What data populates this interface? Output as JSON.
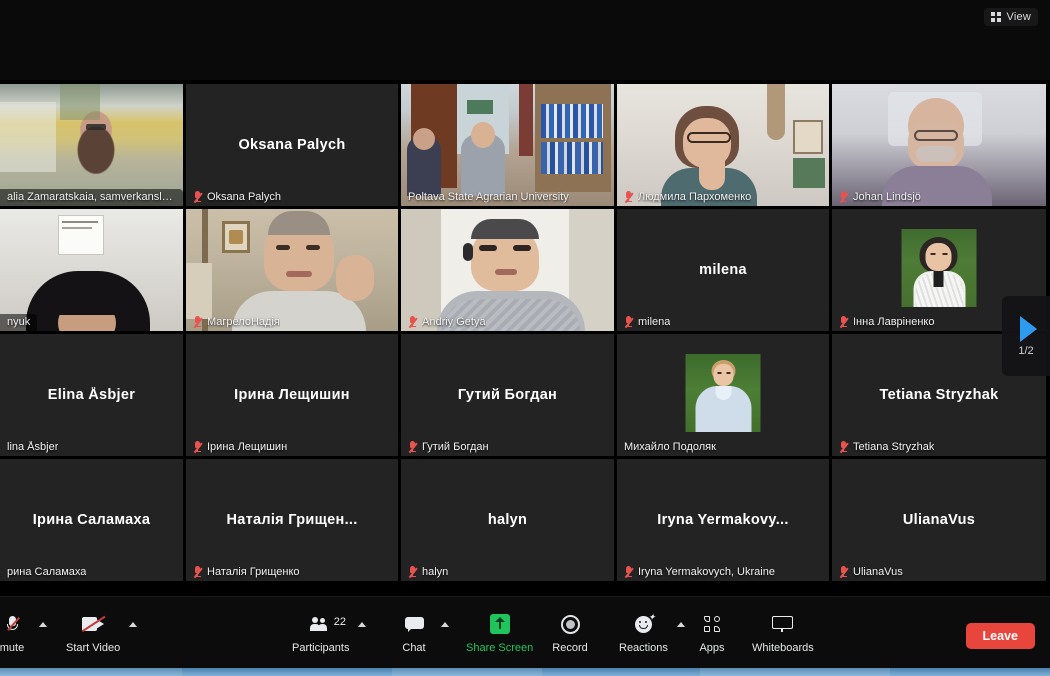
{
  "app": {
    "title": "Zoom Meeting",
    "view_label": "View",
    "view_icon": "grid-icon"
  },
  "page_nav": {
    "counter": "1/2",
    "icon": "next-page-arrow-icon"
  },
  "gallery": {
    "rows": 4,
    "cols": 5,
    "active_tile_color": "#b9e02a",
    "tiles": [
      {
        "id": "t1",
        "name_label": "alia Zamaratskaia, samverkanslekt...",
        "display_name": "",
        "video": true,
        "muted": false,
        "active": false,
        "avatar": false
      },
      {
        "id": "t2",
        "name_label": "Oksana Palych",
        "display_name": "Oksana Palych",
        "video": false,
        "muted": true,
        "active": false,
        "avatar": false
      },
      {
        "id": "t3",
        "name_label": "Poltava State Agrarian University",
        "display_name": "",
        "video": true,
        "muted": false,
        "active": true,
        "avatar": false
      },
      {
        "id": "t4",
        "name_label": "Людмила Пархоменко",
        "display_name": "",
        "video": true,
        "muted": true,
        "active": false,
        "avatar": false
      },
      {
        "id": "t5",
        "name_label": "Johan Lindsjö",
        "display_name": "",
        "video": true,
        "muted": true,
        "active": false,
        "avatar": false
      },
      {
        "id": "t6",
        "name_label": "nyuk",
        "display_name": "",
        "video": true,
        "muted": false,
        "active": false,
        "avatar": false
      },
      {
        "id": "t7",
        "name_label": "МагрелоНадія",
        "display_name": "",
        "video": true,
        "muted": true,
        "active": false,
        "avatar": false
      },
      {
        "id": "t8",
        "name_label": "Andriy Getya",
        "display_name": "",
        "video": true,
        "muted": true,
        "active": false,
        "avatar": false
      },
      {
        "id": "t9",
        "name_label": "milena",
        "display_name": "milena",
        "video": false,
        "muted": true,
        "active": false,
        "avatar": false
      },
      {
        "id": "t10",
        "name_label": "Інна Лавріненко",
        "display_name": "",
        "video": false,
        "muted": true,
        "active": false,
        "avatar": true
      },
      {
        "id": "t11",
        "name_label": "lina Åsbjer",
        "display_name": "Elina Åsbjer",
        "video": false,
        "muted": false,
        "active": false,
        "avatar": false
      },
      {
        "id": "t12",
        "name_label": "Ірина Лещишин",
        "display_name": "Ірина Лещишин",
        "video": false,
        "muted": true,
        "active": false,
        "avatar": false
      },
      {
        "id": "t13",
        "name_label": "Гутий Богдан",
        "display_name": "Гутий Богдан",
        "video": false,
        "muted": true,
        "active": false,
        "avatar": false
      },
      {
        "id": "t14",
        "name_label": "Михайло Подоляк",
        "display_name": "",
        "video": false,
        "muted": false,
        "active": false,
        "avatar": true
      },
      {
        "id": "t15",
        "name_label": "Tetiana Stryzhak",
        "display_name": "Tetiana Stryzhak",
        "video": false,
        "muted": true,
        "active": false,
        "avatar": false
      },
      {
        "id": "t16",
        "name_label": "рина Саламаха",
        "display_name": "Ірина Саламаха",
        "video": false,
        "muted": false,
        "active": false,
        "avatar": false
      },
      {
        "id": "t17",
        "name_label": "Наталія Грищенко",
        "display_name": "Наталія  Грищен...",
        "video": false,
        "muted": true,
        "active": false,
        "avatar": false
      },
      {
        "id": "t18",
        "name_label": "halyn",
        "display_name": "halyn",
        "video": false,
        "muted": true,
        "active": false,
        "avatar": false
      },
      {
        "id": "t19",
        "name_label": "Iryna Yermakovych, Ukraine",
        "display_name": "Iryna  Yermakovy...",
        "video": false,
        "muted": true,
        "active": false,
        "avatar": false
      },
      {
        "id": "t20",
        "name_label": "UlianaVus",
        "display_name": "UlianaVus",
        "video": false,
        "muted": true,
        "active": false,
        "avatar": false
      }
    ]
  },
  "toolbar": {
    "mute_label": "mute",
    "start_video_label": "Start Video",
    "participants_label": "Participants",
    "participants_count": "22",
    "chat_label": "Chat",
    "share_screen_label": "Share Screen",
    "record_label": "Record",
    "reactions_label": "Reactions",
    "apps_label": "Apps",
    "whiteboards_label": "Whiteboards",
    "leave_label": "Leave",
    "share_accent": "#20c45d",
    "leave_accent": "#e8453c"
  }
}
